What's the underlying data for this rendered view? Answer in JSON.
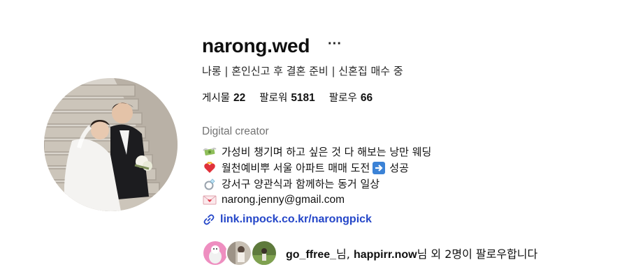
{
  "profile": {
    "username": "narong.wed",
    "more_label": "···",
    "subtitle": "나롱 | 혼인신고 후 결혼 준비 | 신혼집 매수 중",
    "stats": [
      {
        "label": "게시물",
        "value": "22"
      },
      {
        "label": "팔로워",
        "value": "5181"
      },
      {
        "label": "팔로우",
        "value": "66"
      }
    ],
    "category": "Digital creator",
    "bio": {
      "line1": "가성비 챙기며 하고 싶은 것 다 해보는 낭만 웨딩",
      "line2_part1": "월천예비뿌 서울 아파트 매매 도전",
      "line2_part2": "성공",
      "line3": "강서구 양관식과 함께하는 동거 일상",
      "email": "narong.jenny@gmail.com"
    },
    "link": "link.inpock.co.kr/narongpick",
    "followed_by": {
      "user1": "go_ffree_",
      "sep1": "님, ",
      "user2": "happirr.now",
      "rest": "님 외 2명이 팔로우합니다"
    }
  },
  "icons": {
    "line1": "money-with-wings-icon",
    "line2": "heart-on-fire-icon",
    "line2_inline": "right-arrow-icon",
    "line3": "ring-icon",
    "email": "love-letter-icon",
    "link": "link-icon"
  },
  "colors": {
    "link": "#2446c8",
    "category": "#737373"
  }
}
